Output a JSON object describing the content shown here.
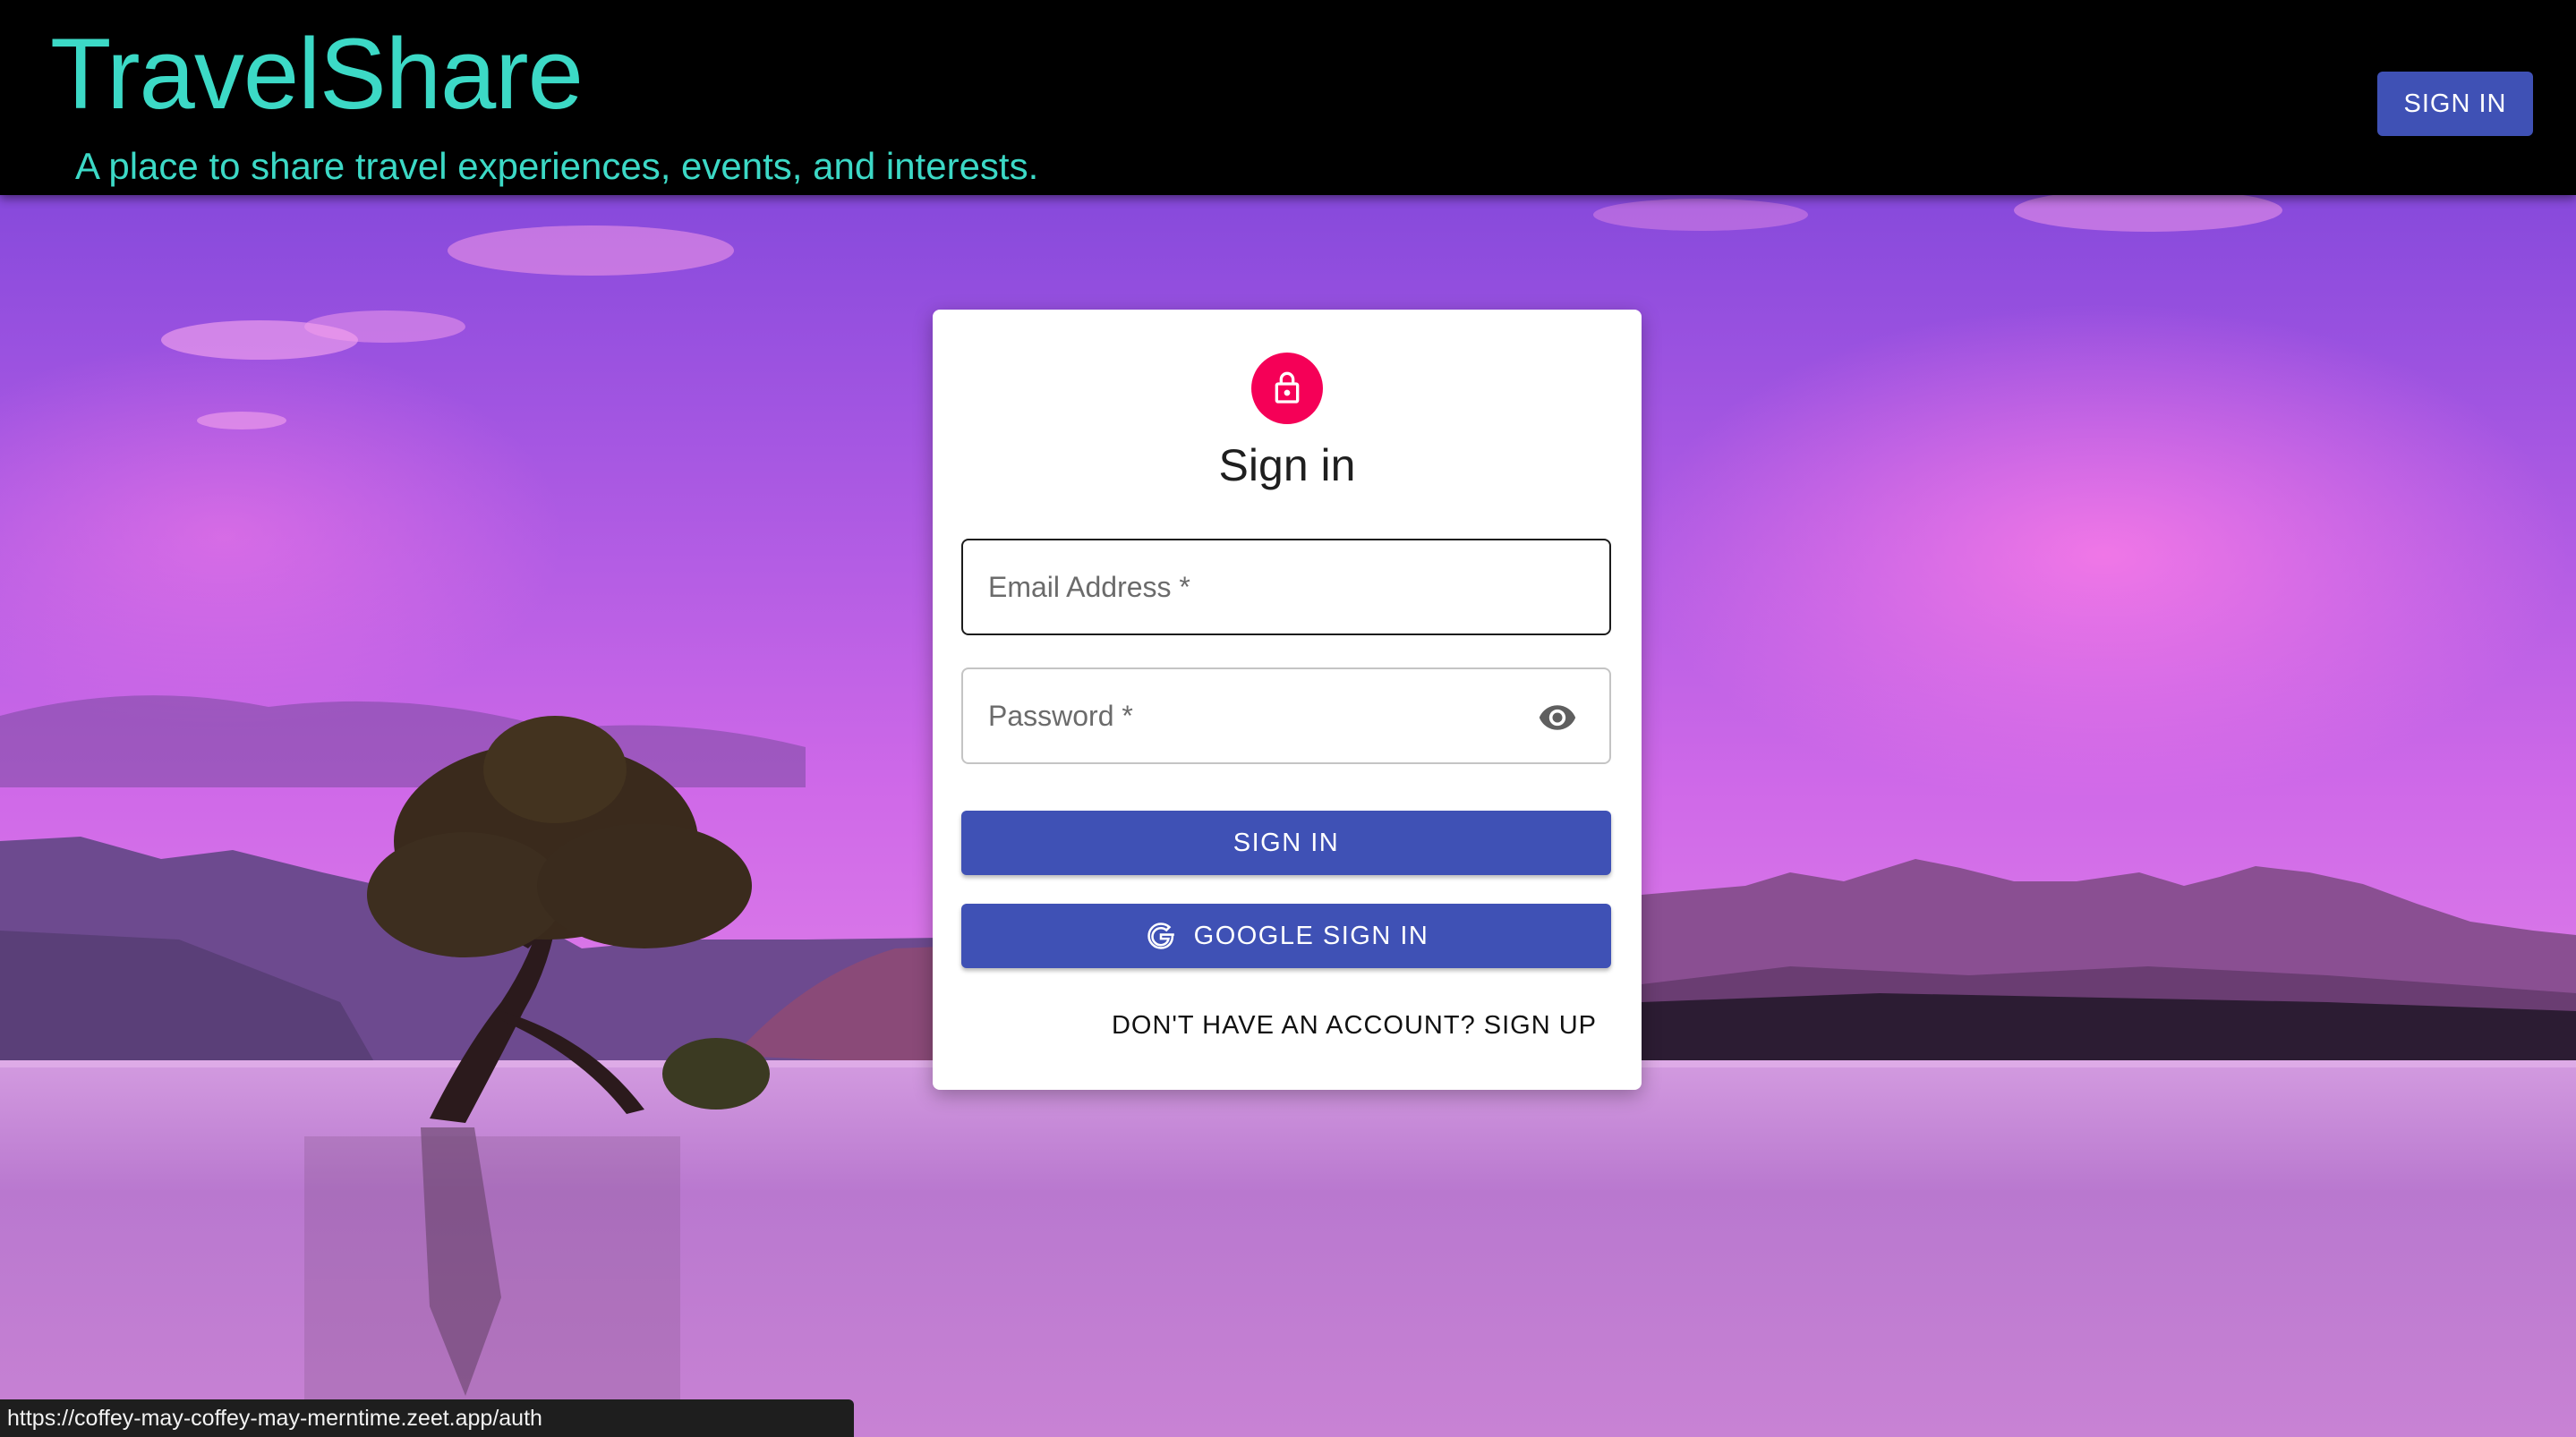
{
  "header": {
    "title": "TravelShare",
    "subtitle": "A place to share travel experiences, events, and interests.",
    "signin_label": "SIGN IN"
  },
  "card": {
    "icon": "lock-icon",
    "title": "Sign in",
    "email_label": "Email Address *",
    "password_label": "Password *",
    "password_toggle_icon": "eye-icon",
    "signin_label": "SIGN IN",
    "google_label": "GOOGLE SIGN IN",
    "google_icon": "google-g-icon",
    "signup_link": "DON'T HAVE AN ACCOUNT? SIGN UP"
  },
  "status_bar": {
    "url": "https://coffey-may-coffey-may-merntime.zeet.app/auth"
  },
  "colors": {
    "header_bg": "#000000",
    "brand_text": "#3cd9c6",
    "primary_button": "#3f51b5",
    "lock_avatar": "#f50057",
    "card_bg": "#ffffff"
  }
}
